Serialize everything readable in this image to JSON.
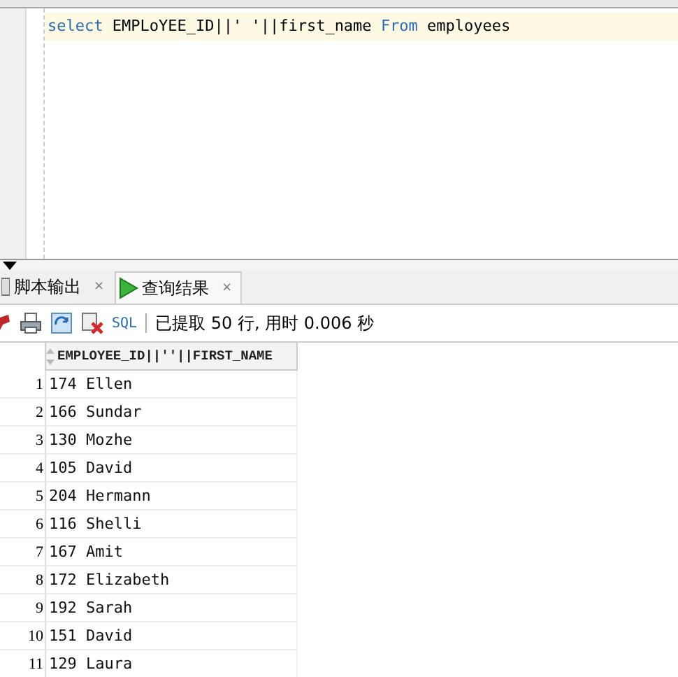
{
  "editor": {
    "lines": [
      {
        "tokens": [
          {
            "kind": "keyword",
            "text": "select"
          },
          {
            "kind": "plain",
            "text": " EMPLoYEE_ID||' '||first_name "
          },
          {
            "kind": "keyword",
            "text": "From"
          },
          {
            "kind": "plain",
            "text": " employees"
          }
        ]
      }
    ]
  },
  "tabs": [
    {
      "label": "脚本输出",
      "kind": "script",
      "close": "×",
      "selected": false
    },
    {
      "label": "查询结果",
      "kind": "query",
      "close": "×",
      "selected": true
    }
  ],
  "toolbar": {
    "sql_label": "SQL",
    "status": "已提取 50 行, 用时 0.006 秒"
  },
  "table": {
    "columns": [
      "EMPLOYEE_ID||''||FIRST_NAME"
    ],
    "rows": [
      {
        "num": "1",
        "value": "174 Ellen"
      },
      {
        "num": "2",
        "value": "166 Sundar"
      },
      {
        "num": "3",
        "value": "130 Mozhe"
      },
      {
        "num": "4",
        "value": "105 David"
      },
      {
        "num": "5",
        "value": "204 Hermann"
      },
      {
        "num": "6",
        "value": "116 Shelli"
      },
      {
        "num": "7",
        "value": "167 Amit"
      },
      {
        "num": "8",
        "value": "172 Elizabeth"
      },
      {
        "num": "9",
        "value": "192 Sarah"
      },
      {
        "num": "10",
        "value": "151 David"
      },
      {
        "num": "11",
        "value": "129 Laura"
      }
    ]
  }
}
